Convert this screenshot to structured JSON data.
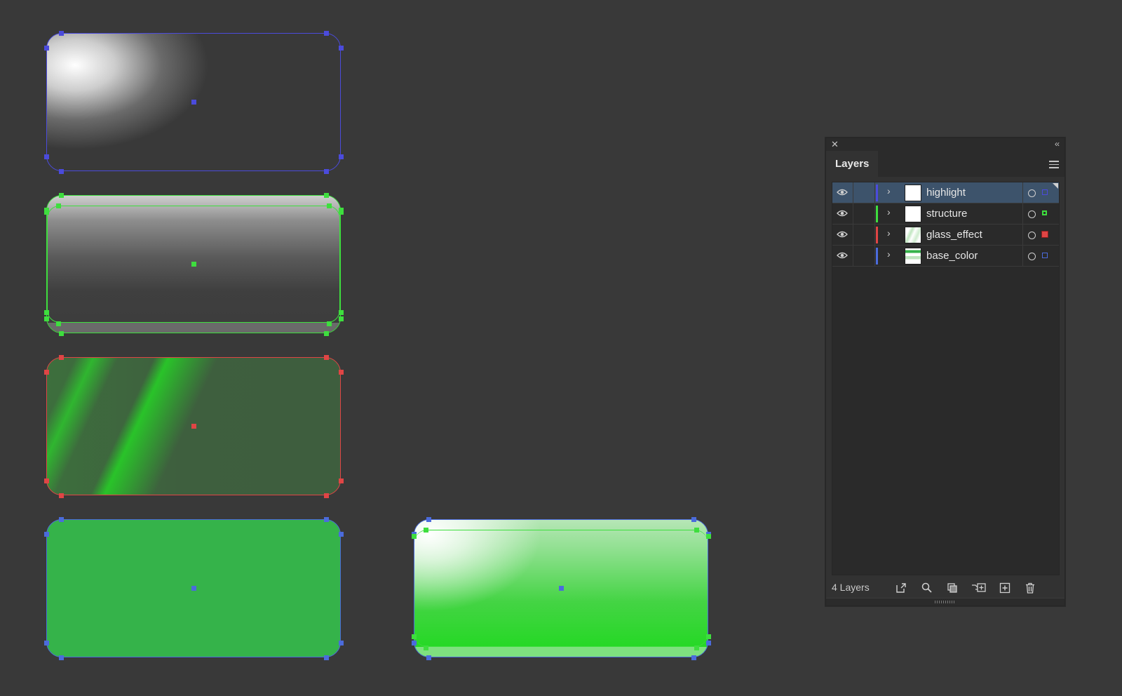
{
  "canvas": {
    "background": "#393939",
    "shapes": [
      {
        "id": "highlight",
        "outline_color": "#4b4bdc"
      },
      {
        "id": "structure",
        "outline_color": "#3ede3e"
      },
      {
        "id": "glass_effect",
        "outline_color": "#e04545"
      },
      {
        "id": "base_color",
        "outline_color": "#4b6bdc",
        "fill": "#35b34a"
      },
      {
        "id": "combined_button",
        "outline_color": "#4b6bdc"
      }
    ]
  },
  "layers_panel": {
    "tab_label": "Layers",
    "close_icon": "close-icon",
    "collapse_icon": "collapse-icon",
    "menu_icon": "panel-menu-icon",
    "layers": [
      {
        "name": "highlight",
        "color": "#4b4bdc",
        "selected": true
      },
      {
        "name": "structure",
        "color": "#3ede3e",
        "selected": false
      },
      {
        "name": "glass_effect",
        "color": "#e04545",
        "selected": false
      },
      {
        "name": "base_color",
        "color": "#4b6bdc",
        "selected": false
      }
    ],
    "footer": {
      "count_label": "4 Layers",
      "icons": [
        "export-icon",
        "search-icon",
        "clipping-mask-icon",
        "new-sublayer-icon",
        "new-layer-icon",
        "trash-icon"
      ]
    }
  }
}
